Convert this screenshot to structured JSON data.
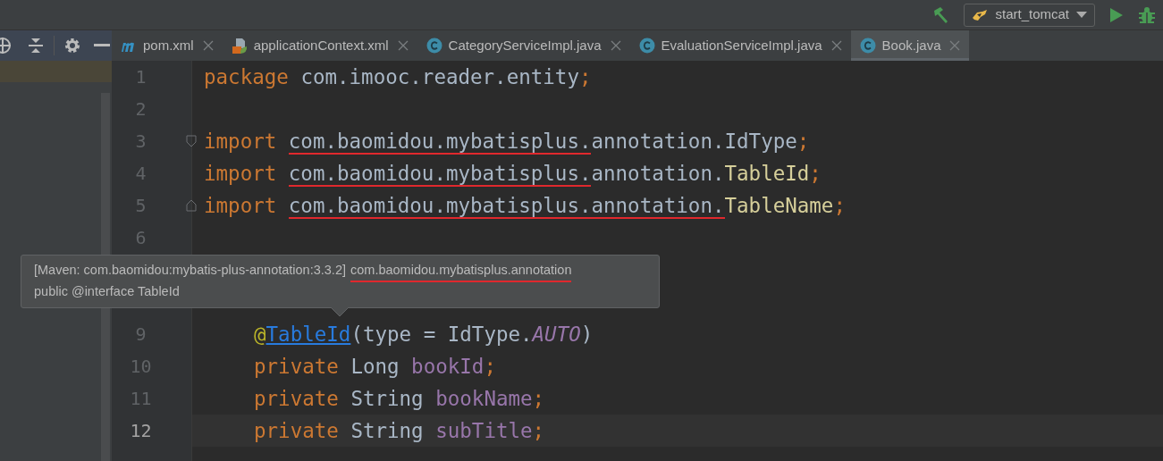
{
  "toolbar": {
    "run_configuration": "start_tomcat"
  },
  "tabs": [
    {
      "label": "pom.xml",
      "kind": "maven",
      "selected": false
    },
    {
      "label": "applicationContext.xml",
      "kind": "spring",
      "selected": false
    },
    {
      "label": "CategoryServiceImpl.java",
      "kind": "class",
      "selected": false
    },
    {
      "label": "EvaluationServiceImpl.java",
      "kind": "class",
      "selected": false
    },
    {
      "label": "Book.java",
      "kind": "class",
      "selected": true
    }
  ],
  "editor": {
    "lines_above_tooltip": [
      {
        "number": "1",
        "current": false,
        "tokens": [
          {
            "text": "package ",
            "kind": "keyword"
          },
          {
            "text": "com.imooc.reader.entity",
            "kind": "plain"
          },
          {
            "text": ";",
            "kind": "keyword"
          }
        ]
      },
      {
        "number": "2",
        "current": false
      },
      {
        "number": "3",
        "current": false,
        "fold_start": true,
        "tokens": [
          {
            "text": "import ",
            "kind": "keyword"
          },
          {
            "text": "com.baomidou.mybatisplus.",
            "kind": "plain",
            "marked": true
          },
          {
            "text": "annotation.IdType",
            "kind": "plain"
          },
          {
            "text": ";",
            "kind": "keyword"
          }
        ]
      },
      {
        "number": "4",
        "current": false,
        "tokens": [
          {
            "text": "import ",
            "kind": "keyword"
          },
          {
            "text": "com.baomidou.mybatisplus.",
            "kind": "plain",
            "marked": true
          },
          {
            "text": "annotation.",
            "kind": "plain"
          },
          {
            "text": "TableId",
            "kind": "class"
          },
          {
            "text": ";",
            "kind": "keyword"
          }
        ]
      },
      {
        "number": "5",
        "current": false,
        "fold_end": true,
        "tokens": [
          {
            "text": "import ",
            "kind": "keyword"
          },
          {
            "text": "com.baomidou.mybatisplus.annotation.",
            "kind": "plain",
            "marked": true
          },
          {
            "text": "TableName",
            "kind": "class"
          },
          {
            "text": ";",
            "kind": "keyword"
          }
        ]
      },
      {
        "number": "6",
        "current": false
      }
    ],
    "lines_below_tooltip": [
      {
        "number": "9",
        "current": false,
        "tokens": [
          {
            "text": "@",
            "kind": "annotation"
          },
          {
            "text": "TableId",
            "kind": "link"
          },
          {
            "text": "(type = IdType.",
            "kind": "plain"
          },
          {
            "text": "AUTO",
            "kind": "constant"
          },
          {
            "text": ")",
            "kind": "plain"
          }
        ]
      },
      {
        "number": "10",
        "current": false,
        "tokens": [
          {
            "text": "private ",
            "kind": "keyword"
          },
          {
            "text": "Long ",
            "kind": "plain"
          },
          {
            "text": "bookId",
            "kind": "field"
          },
          {
            "text": ";",
            "kind": "keyword"
          }
        ]
      },
      {
        "number": "11",
        "current": false,
        "tokens": [
          {
            "text": "private ",
            "kind": "keyword"
          },
          {
            "text": "String ",
            "kind": "plain"
          },
          {
            "text": "bookName",
            "kind": "field"
          },
          {
            "text": ";",
            "kind": "keyword"
          }
        ]
      },
      {
        "number": "12",
        "current": true,
        "tokens": [
          {
            "text": "private ",
            "kind": "keyword"
          },
          {
            "text": "String ",
            "kind": "plain"
          },
          {
            "text": "subTitle",
            "kind": "field"
          },
          {
            "text": ";",
            "kind": "keyword"
          }
        ]
      }
    ]
  },
  "tooltip": {
    "lines": [
      [
        {
          "text": "[Maven: com.baomidou:mybatis-plus-annotation:3.3.2]",
          "marked": false
        },
        {
          "text": "com.baomidou.mybatisplus.annotation",
          "marked": true
        }
      ],
      [
        {
          "text": "public @interface TableId",
          "marked": false
        }
      ]
    ]
  }
}
